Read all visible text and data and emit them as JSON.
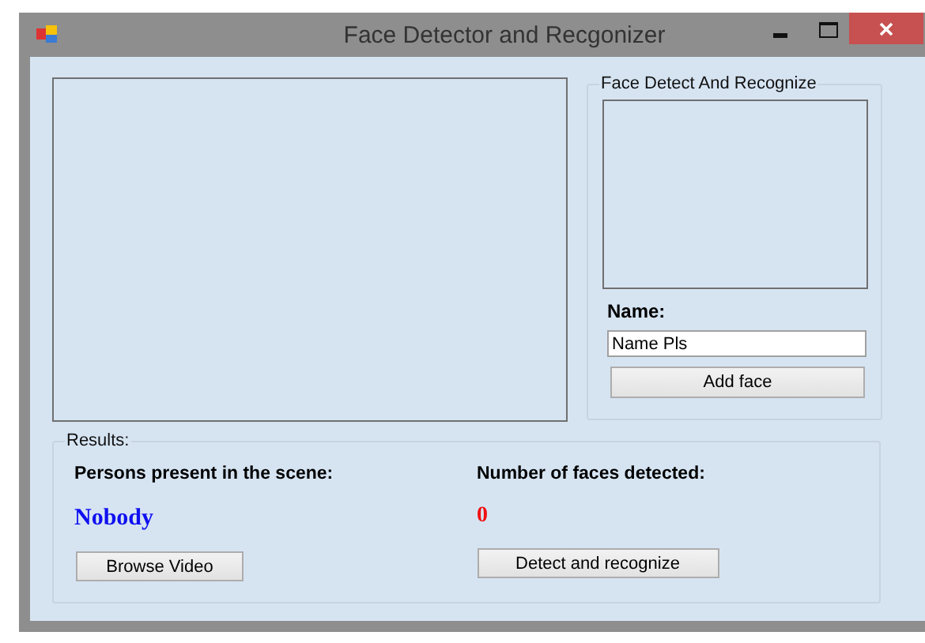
{
  "window": {
    "title": "Face Detector and Recgonizer"
  },
  "face_group": {
    "title": "Face Detect And Recognize",
    "name_label": "Name:",
    "name_input": {
      "value": "Name Pls"
    },
    "add_button": "Add face"
  },
  "results": {
    "title": "Results:",
    "persons_label": "Persons present in the scene:",
    "persons_value": "Nobody",
    "faces_label": "Number of faces detected:",
    "faces_value": "0",
    "browse_button": "Browse Video",
    "detect_button": "Detect and recognize"
  }
}
